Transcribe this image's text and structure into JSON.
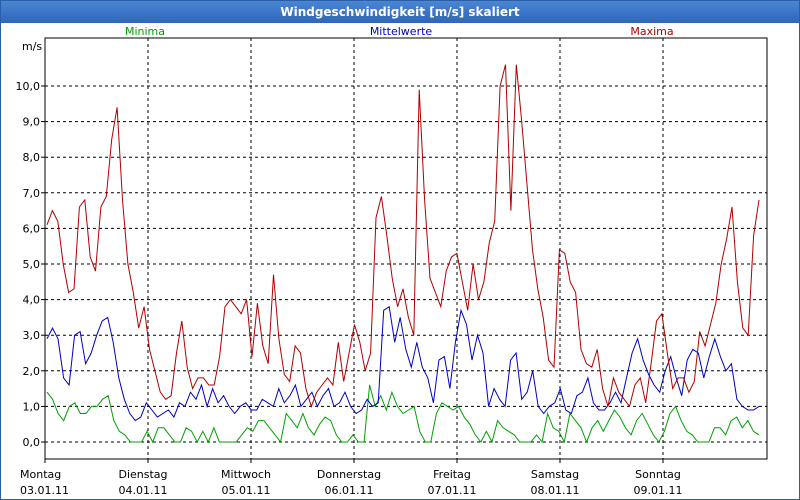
{
  "window": {
    "title": "Windgeschwindigkeit [m/s] skaliert"
  },
  "chart_data": {
    "type": "line",
    "title": "Windgeschwindigkeit [m/s] skaliert",
    "ylabel": "m/s",
    "ylim": [
      0,
      10.8
    ],
    "grid": true,
    "legend_placement": "top",
    "y_ticks": [
      "0,0",
      "1,0",
      "2,0",
      "3,0",
      "4,0",
      "5,0",
      "6,0",
      "7,0",
      "8,0",
      "9,0",
      "10,0"
    ],
    "x_labels": [
      {
        "day": "Montag",
        "date": "03.01.11"
      },
      {
        "day": "Dienstag",
        "date": "04.01.11"
      },
      {
        "day": "Mittwoch",
        "date": "05.01.11"
      },
      {
        "day": "Donnerstag",
        "date": "06.01.11"
      },
      {
        "day": "Freitag",
        "date": "07.01.11"
      },
      {
        "day": "Samstag",
        "date": "08.01.11"
      },
      {
        "day": "Sonntag",
        "date": "09.01.11"
      }
    ],
    "series": [
      {
        "name": "Minima",
        "color": "#00a000",
        "values": [
          1.4,
          1.2,
          0.8,
          0.6,
          1.0,
          1.1,
          0.8,
          0.8,
          1.0,
          1.0,
          1.2,
          1.3,
          0.6,
          0.3,
          0.2,
          0.0,
          0.0,
          0.0,
          0.3,
          0.0,
          0.4,
          0.4,
          0.2,
          0.0,
          0.0,
          0.4,
          0.3,
          0.0,
          0.3,
          0.0,
          0.4,
          0.0,
          0.0,
          0.0,
          0.0,
          0.2,
          0.4,
          0.3,
          0.6,
          0.6,
          0.4,
          0.2,
          0.0,
          0.8,
          0.6,
          0.4,
          0.8,
          0.4,
          0.2,
          0.5,
          0.7,
          0.6,
          0.2,
          0.0,
          0.0,
          0.2,
          0.0,
          0.0,
          1.6,
          1.0,
          1.3,
          0.9,
          1.4,
          1.0,
          0.8,
          0.9,
          1.0,
          0.3,
          0.0,
          0.0,
          0.8,
          1.1,
          1.0,
          0.9,
          1.0,
          0.7,
          0.5,
          0.2,
          0.0,
          0.3,
          0.0,
          0.6,
          0.4,
          0.3,
          0.2,
          0.0,
          0.0,
          0.0,
          0.2,
          0.0,
          0.8,
          0.4,
          0.3,
          0.0,
          0.8,
          0.6,
          0.4,
          0.0,
          0.4,
          0.6,
          0.3,
          0.6,
          0.9,
          0.7,
          0.4,
          0.2,
          0.6,
          0.8,
          0.5,
          0.2,
          0.0,
          0.3,
          0.8,
          1.0,
          0.6,
          0.3,
          0.2,
          0.0,
          0.0,
          0.0,
          0.4,
          0.4,
          0.2,
          0.6,
          0.7,
          0.4,
          0.6,
          0.3,
          0.2
        ]
      },
      {
        "name": "Mittelwerte",
        "color": "#0000c0",
        "values": [
          2.9,
          3.2,
          2.9,
          1.8,
          1.6,
          3.0,
          3.1,
          2.2,
          2.5,
          3.0,
          3.4,
          3.5,
          2.8,
          1.8,
          1.2,
          0.8,
          0.6,
          0.7,
          1.1,
          0.9,
          0.7,
          0.8,
          0.9,
          0.7,
          1.1,
          1.0,
          1.4,
          1.2,
          1.6,
          1.0,
          1.5,
          1.1,
          1.3,
          1.0,
          0.8,
          1.0,
          1.1,
          0.9,
          0.9,
          1.2,
          1.1,
          1.0,
          1.5,
          1.1,
          1.3,
          1.6,
          1.0,
          1.2,
          1.4,
          1.0,
          1.3,
          1.5,
          1.0,
          1.1,
          1.4,
          1.0,
          0.8,
          0.9,
          1.2,
          1.0,
          1.1,
          3.7,
          3.8,
          2.8,
          3.5,
          2.6,
          2.1,
          2.8,
          2.1,
          1.8,
          1.1,
          2.3,
          2.4,
          1.5,
          2.8,
          3.7,
          3.3,
          2.3,
          3.0,
          2.5,
          1.0,
          1.5,
          1.2,
          1.0,
          2.3,
          2.5,
          1.2,
          1.4,
          2.0,
          1.0,
          0.8,
          1.0,
          1.1,
          1.5,
          0.9,
          0.8,
          1.3,
          1.4,
          1.8,
          1.1,
          0.9,
          0.9,
          1.1,
          1.4,
          1.1,
          1.8,
          2.5,
          2.9,
          2.3,
          1.9,
          1.6,
          1.4,
          2.0,
          2.4,
          1.8,
          1.3,
          2.3,
          2.6,
          2.5,
          1.8,
          2.4,
          2.9,
          2.4,
          2.0,
          2.2,
          1.2,
          1.0,
          0.9,
          0.9,
          1.0
        ]
      },
      {
        "name": "Maxima",
        "color": "#b00000",
        "values": [
          6.1,
          6.5,
          6.2,
          5.0,
          4.2,
          4.3,
          6.6,
          6.8,
          5.2,
          4.8,
          6.6,
          6.9,
          8.5,
          9.4,
          6.8,
          5.0,
          4.2,
          3.2,
          3.8,
          2.6,
          2.0,
          1.4,
          1.2,
          1.3,
          2.5,
          3.4,
          2.1,
          1.5,
          1.8,
          1.8,
          1.6,
          1.6,
          2.4,
          3.8,
          4.0,
          3.8,
          3.6,
          4.0,
          2.4,
          3.9,
          2.7,
          2.2,
          4.7,
          2.9,
          1.9,
          1.7,
          2.7,
          2.5,
          1.5,
          1.0,
          1.4,
          1.6,
          1.8,
          1.6,
          2.8,
          1.7,
          2.5,
          3.3,
          2.8,
          2.0,
          2.5,
          6.3,
          6.9,
          5.8,
          4.6,
          3.8,
          4.3,
          3.5,
          3.0,
          9.9,
          6.8,
          4.6,
          4.2,
          3.8,
          4.8,
          5.2,
          5.3,
          4.5,
          3.7,
          5.0,
          4.0,
          4.5,
          5.6,
          6.2,
          10.0,
          10.6,
          6.5,
          10.6,
          9.0,
          7.2,
          5.4,
          4.3,
          3.5,
          2.3,
          2.1,
          5.4,
          5.3,
          4.5,
          4.2,
          2.6,
          2.2,
          2.1,
          2.6,
          1.5,
          1.0,
          1.8,
          1.4,
          1.2,
          1.0,
          1.6,
          1.8,
          1.1,
          2.2,
          3.4,
          3.6,
          2.5,
          1.5,
          1.8,
          1.8,
          1.4,
          1.7,
          3.1,
          2.7,
          3.3,
          3.9,
          5.0,
          5.7,
          6.6,
          4.5,
          3.2,
          3.0,
          5.8,
          6.8
        ]
      }
    ]
  }
}
